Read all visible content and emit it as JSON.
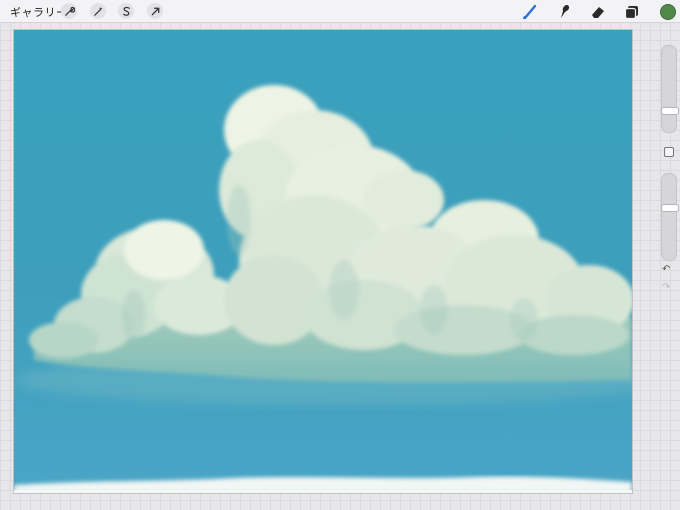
{
  "toolbar": {
    "gallery_label": "ギャラリー",
    "left_tools": [
      "wrench-icon",
      "magic-wand-icon",
      "selection-icon",
      "transform-arrow-icon"
    ],
    "right_tools": [
      "brush-icon",
      "smudge-icon",
      "eraser-icon",
      "layers-icon"
    ],
    "active_tool": "brush-icon",
    "active_color": "#4f8a4a",
    "accent_color": "#2f6fd6"
  },
  "sidebar": {
    "brush_size_level": 0.75,
    "opacity_level": 0.3,
    "controls": [
      "brush-size-slider",
      "modify-button",
      "opacity-slider",
      "undo-button",
      "redo-button"
    ]
  },
  "canvas": {
    "sky_color": "#3a9fbc",
    "cloud_color": "#e9f0df"
  }
}
